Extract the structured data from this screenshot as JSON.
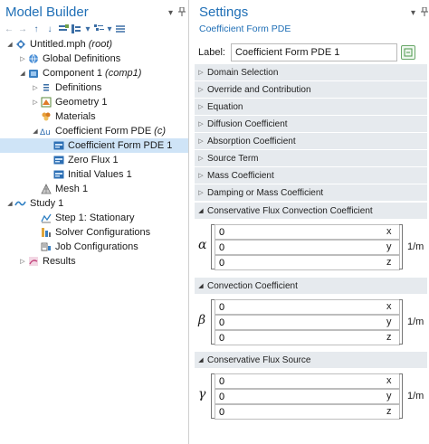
{
  "model_builder": {
    "title": "Model Builder",
    "tree": [
      {
        "label": "Untitled.mph",
        "sub": "(root)",
        "icon": "root-icon",
        "depth": 0,
        "twisty": "open"
      },
      {
        "label": "Global Definitions",
        "sub": "",
        "icon": "global-definitions-icon",
        "depth": 1,
        "twisty": "closed"
      },
      {
        "label": "Component 1",
        "sub": "(comp1)",
        "icon": "component-icon",
        "depth": 1,
        "twisty": "open"
      },
      {
        "label": "Definitions",
        "sub": "",
        "icon": "definitions-icon",
        "depth": 2,
        "twisty": "closed"
      },
      {
        "label": "Geometry 1",
        "sub": "",
        "icon": "geometry-icon",
        "depth": 2,
        "twisty": "closed"
      },
      {
        "label": "Materials",
        "sub": "",
        "icon": "materials-icon",
        "depth": 2,
        "twisty": "none"
      },
      {
        "label": "Coefficient Form PDE",
        "sub": "(c)",
        "icon": "pde-icon",
        "depth": 2,
        "twisty": "open"
      },
      {
        "label": "Coefficient Form PDE 1",
        "sub": "",
        "icon": "pde-node-icon",
        "depth": 3,
        "twisty": "none",
        "selected": true
      },
      {
        "label": "Zero Flux 1",
        "sub": "",
        "icon": "pde-node-icon",
        "depth": 3,
        "twisty": "none"
      },
      {
        "label": "Initial Values 1",
        "sub": "",
        "icon": "pde-node-icon",
        "depth": 3,
        "twisty": "none"
      },
      {
        "label": "Mesh 1",
        "sub": "",
        "icon": "mesh-icon",
        "depth": 2,
        "twisty": "none"
      },
      {
        "label": "Study 1",
        "sub": "",
        "icon": "study-icon",
        "depth": 1,
        "twisty": "open"
      },
      {
        "label": "Step 1: Stationary",
        "sub": "",
        "icon": "step-icon",
        "depth": 2,
        "twisty": "none"
      },
      {
        "label": "Solver Configurations",
        "sub": "",
        "icon": "solver-icon",
        "depth": 2,
        "twisty": "none"
      },
      {
        "label": "Job Configurations",
        "sub": "",
        "icon": "job-icon",
        "depth": 2,
        "twisty": "none"
      },
      {
        "label": "Results",
        "sub": "",
        "icon": "results-icon",
        "depth": 1,
        "twisty": "closed"
      }
    ]
  },
  "settings": {
    "title": "Settings",
    "subtitle": "Coefficient Form PDE",
    "label_caption": "Label:",
    "label_value": "Coefficient Form PDE 1",
    "sections": [
      {
        "label": "Domain Selection",
        "open": false
      },
      {
        "label": "Override and Contribution",
        "open": false
      },
      {
        "label": "Equation",
        "open": false
      },
      {
        "label": "Diffusion Coefficient",
        "open": false
      },
      {
        "label": "Absorption Coefficient",
        "open": false
      },
      {
        "label": "Source Term",
        "open": false
      },
      {
        "label": "Mass Coefficient",
        "open": false
      },
      {
        "label": "Damping or Mass Coefficient",
        "open": false
      },
      {
        "label": "Conservative Flux Convection Coefficient",
        "open": true
      },
      {
        "label": "Convection Coefficient",
        "open": true
      },
      {
        "label": "Conservative Flux Source",
        "open": true
      }
    ],
    "matrices": [
      {
        "symbol": "α",
        "values": [
          "0",
          "0",
          "0"
        ],
        "components": [
          "x",
          "y",
          "z"
        ],
        "unit": "1/m"
      },
      {
        "symbol": "β",
        "values": [
          "0",
          "0",
          "0"
        ],
        "components": [
          "x",
          "y",
          "z"
        ],
        "unit": "1/m"
      },
      {
        "symbol": "γ",
        "values": [
          "0",
          "0",
          "0"
        ],
        "components": [
          "x",
          "y",
          "z"
        ],
        "unit": "1/m"
      }
    ]
  },
  "colors": {
    "accent": "#1f6fb6",
    "selection": "#cfe4f7",
    "section_bg": "#e6eaee"
  }
}
